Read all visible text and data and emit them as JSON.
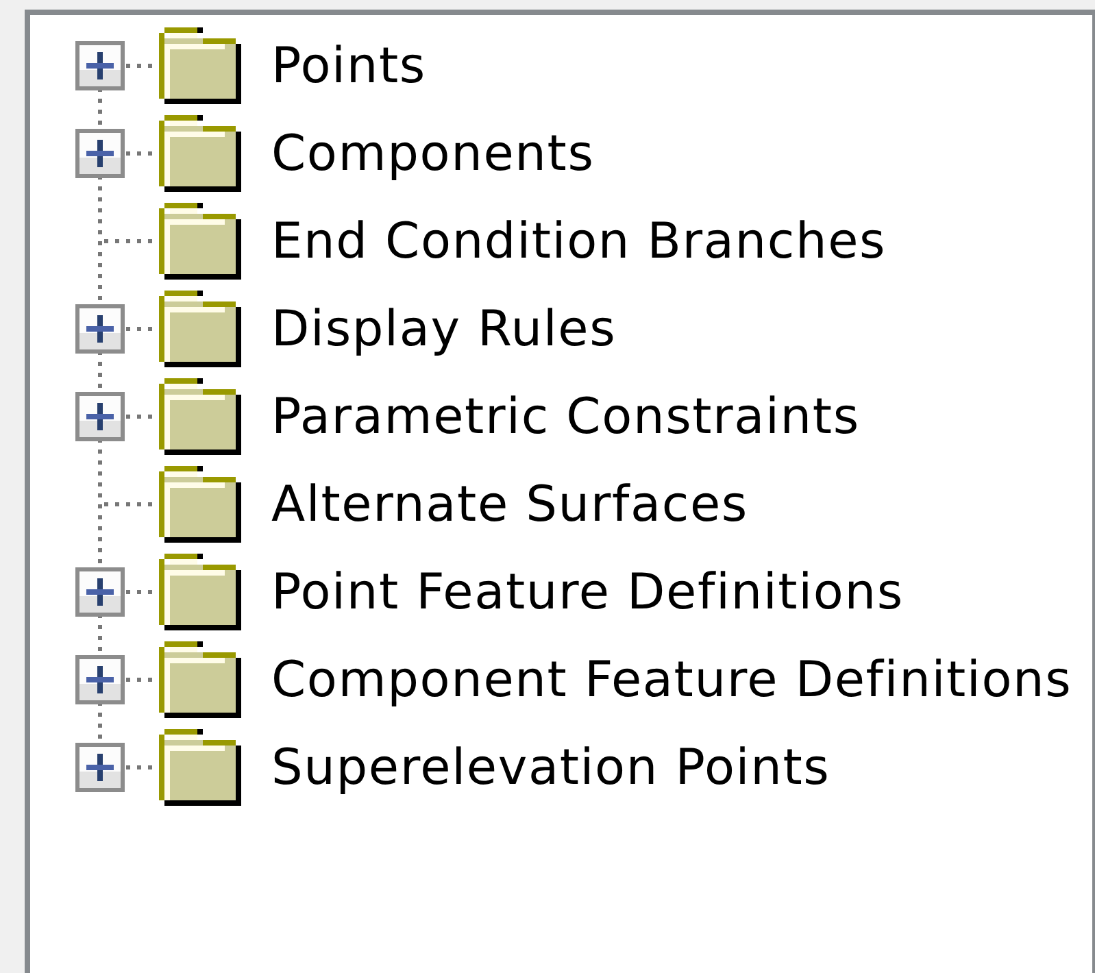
{
  "tree": {
    "items": [
      {
        "label": "Points",
        "kind": "collapsed"
      },
      {
        "label": "Components",
        "kind": "collapsed"
      },
      {
        "label": "End Condition Branches",
        "kind": "leaf"
      },
      {
        "label": "Display Rules",
        "kind": "collapsed"
      },
      {
        "label": "Parametric Constraints",
        "kind": "collapsed"
      },
      {
        "label": "Alternate Surfaces",
        "kind": "leaf"
      },
      {
        "label": "Point Feature Definitions",
        "kind": "collapsed"
      },
      {
        "label": "Component Feature Definitions",
        "kind": "collapsed"
      },
      {
        "label": "Superelevation Points",
        "kind": "collapsed"
      }
    ]
  }
}
